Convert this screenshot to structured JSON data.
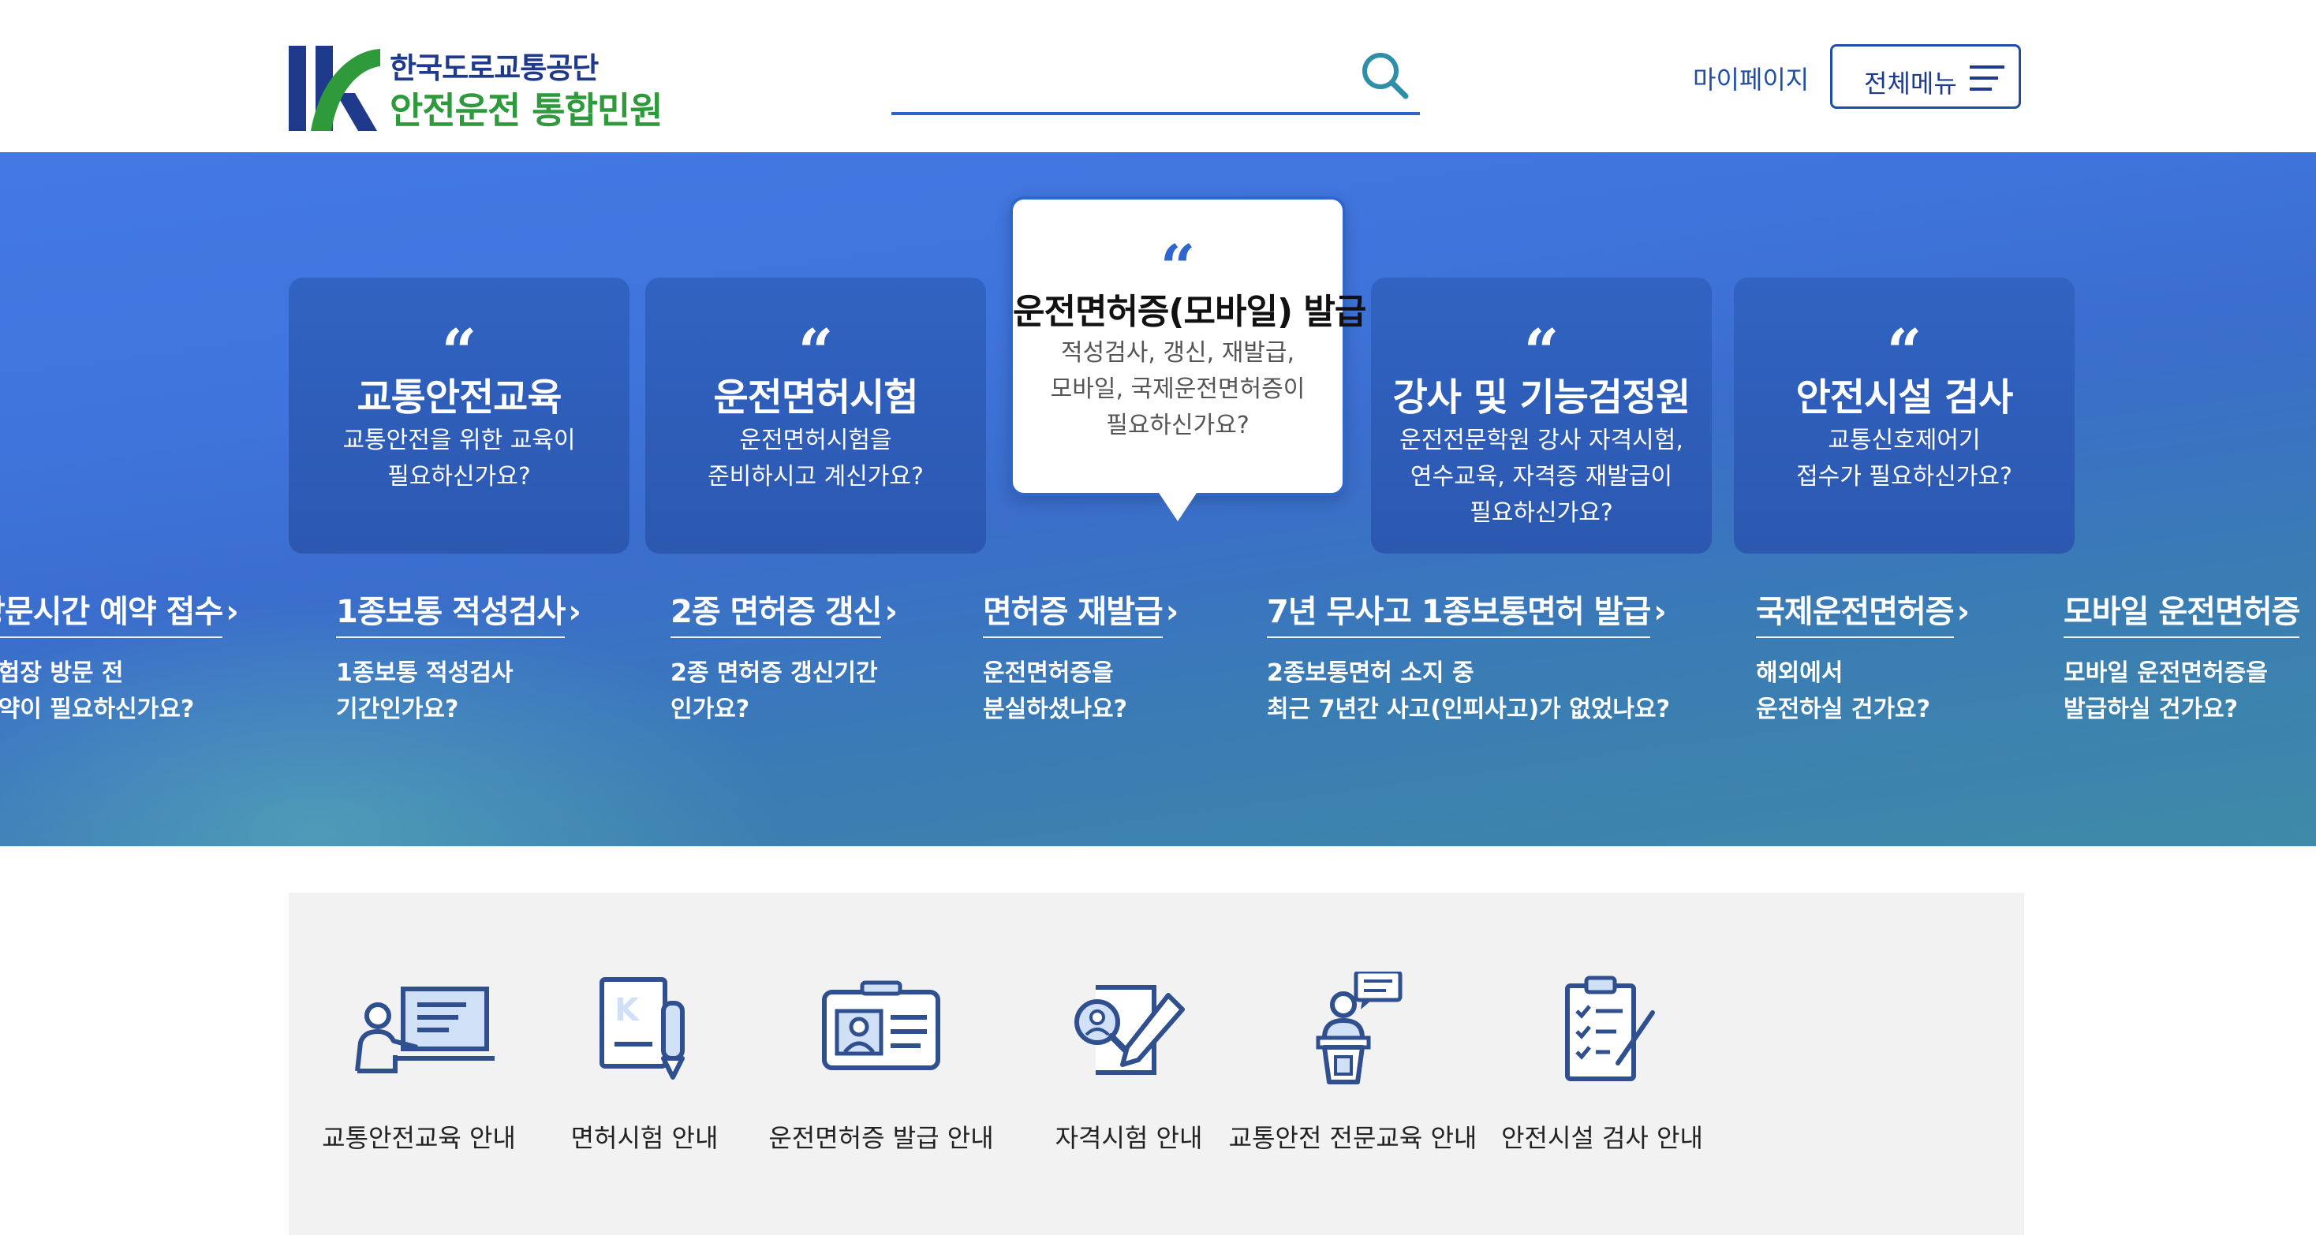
{
  "header": {
    "logo_line1": "한국도로교통공단",
    "logo_line2": "안전운전 통합민원",
    "search_placeholder": "",
    "mypage_label": "마이페이지",
    "allmenu_label": "전체메뉴"
  },
  "hero": {
    "cards": [
      {
        "title": "교통안전교육",
        "desc": "교통안전을 위한 교육이\n필요하신가요?"
      },
      {
        "title": "운전면허시험",
        "desc": "운전면허시험을\n준비하시고 계신가요?"
      },
      {
        "title": "운전면허증(모바일) 발급",
        "desc": "적성검사, 갱신, 재발급,\n모바일, 국제운전면허증이\n필요하신가요?",
        "active": true
      },
      {
        "title": "강사 및 기능검정원",
        "desc": "운전전문학원 강사 자격시험,\n연수교육, 자격증 재발급이\n필요하신가요?"
      },
      {
        "title": "안전시설 검사",
        "desc": "교통신호제어기\n접수가 필요하신가요?"
      }
    ],
    "quick_links": [
      {
        "title": "방문시간 예약 접수",
        "desc": "시험장 방문 전\n예약이 필요하신가요?"
      },
      {
        "title": "1종보통 적성검사",
        "desc": "1종보통 적성검사\n기간인가요?"
      },
      {
        "title": "2종 면허증 갱신",
        "desc": "2종 면허증 갱신기간\n인가요?"
      },
      {
        "title": "면허증 재발급",
        "desc": "운전면허증을\n분실하셨나요?"
      },
      {
        "title": "7년 무사고 1종보통면허 발급",
        "desc": "2종보통면허 소지 중\n최근 7년간 사고(인피사고)가 없었나요?"
      },
      {
        "title": "국제운전면허증",
        "desc": "해외에서\n운전하실 건가요?"
      },
      {
        "title": "모바일 운전면허증",
        "desc": "모바일 운전면허증을\n발급하실 건가요?"
      }
    ]
  },
  "guide": {
    "items": [
      {
        "label": "교통안전교육 안내",
        "icon": "lecture-icon"
      },
      {
        "label": "면허시험 안내",
        "icon": "exam-document-icon"
      },
      {
        "label": "운전면허증 발급 안내",
        "icon": "license-card-icon"
      },
      {
        "label": "자격시험 안내",
        "icon": "qualification-test-icon"
      },
      {
        "label": "교통안전 전문교육 안내",
        "icon": "speaker-podium-icon"
      },
      {
        "label": "안전시설 검사 안내",
        "icon": "checklist-icon"
      }
    ]
  },
  "colors": {
    "brand_blue": "#1f4ea8",
    "brand_green": "#2e9a3c",
    "hero_blue": "#4479e4",
    "card_blue": "#2f5db8",
    "icon_blue": "#2f4f8f",
    "icon_fill": "#cfe0f7"
  }
}
